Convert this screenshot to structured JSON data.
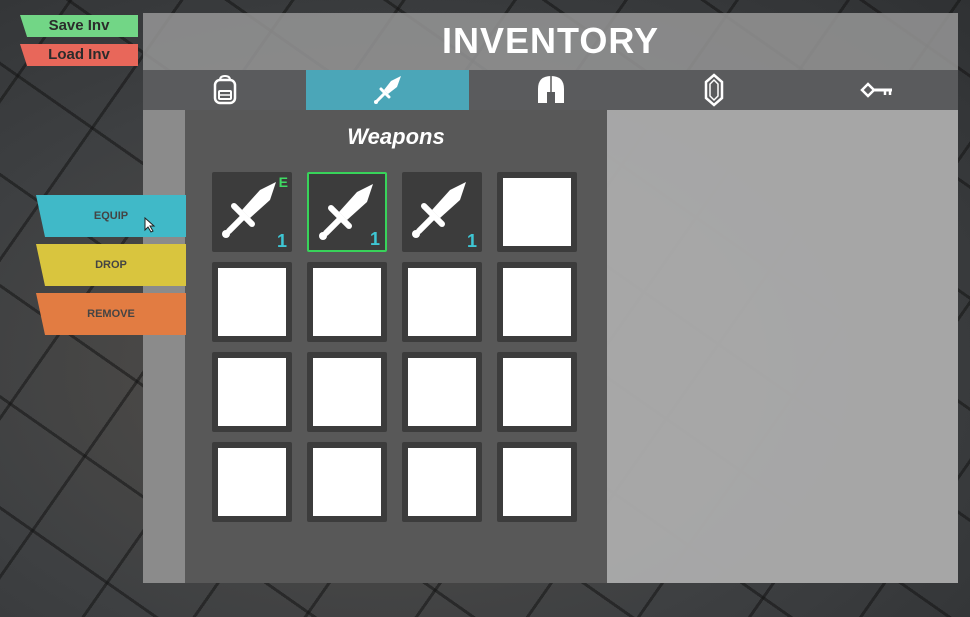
{
  "top_buttons": {
    "save": "Save Inv",
    "load": "Load Inv"
  },
  "panel": {
    "title": "INVENTORY",
    "tabs": [
      {
        "icon": "backpack-icon",
        "active": false
      },
      {
        "icon": "sword-icon",
        "active": true
      },
      {
        "icon": "helmet-icon",
        "active": false
      },
      {
        "icon": "gem-icon",
        "active": false
      },
      {
        "icon": "key-icon",
        "active": false
      }
    ],
    "section_title": "Weapons",
    "slots": [
      {
        "item": "sword",
        "quantity": "1",
        "equipped_mark": "E"
      },
      {
        "item": "sword",
        "quantity": "1",
        "selected": true
      },
      {
        "item": "sword",
        "quantity": "1"
      },
      {
        "item": null
      },
      {
        "item": null
      },
      {
        "item": null
      },
      {
        "item": null
      },
      {
        "item": null
      },
      {
        "item": null
      },
      {
        "item": null
      },
      {
        "item": null
      },
      {
        "item": null
      },
      {
        "item": null
      },
      {
        "item": null
      },
      {
        "item": null
      },
      {
        "item": null
      }
    ]
  },
  "actions": {
    "equip": "EQUIP",
    "drop": "DROP",
    "remove": "REMOVE"
  },
  "colors": {
    "tab_active": "#4ba6b8",
    "equip": "#40b9c8",
    "drop": "#d9c53e",
    "remove": "#e27c42",
    "save": "#72d686",
    "load": "#e8675a",
    "quantity": "#3ec6d4",
    "selected_border": "#38d35a"
  }
}
